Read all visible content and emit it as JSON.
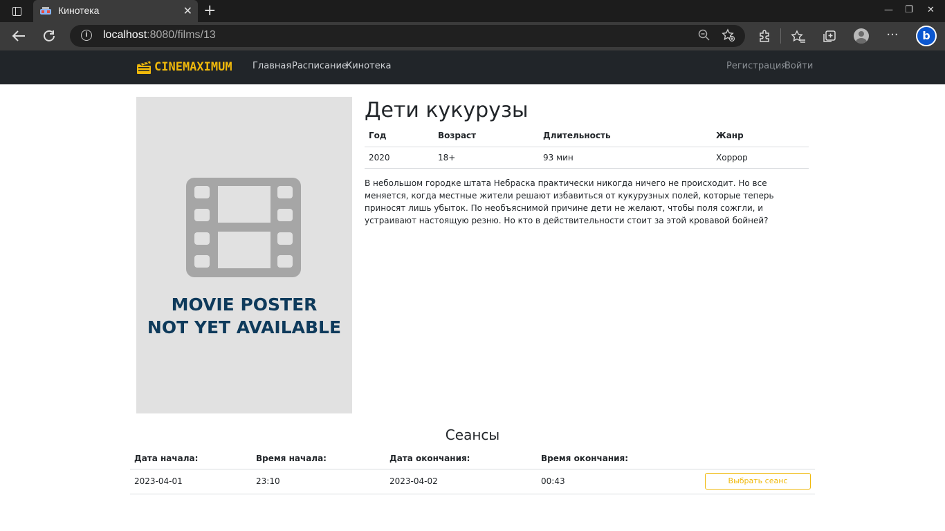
{
  "browser": {
    "tab_title": "Кинотека",
    "url_host": "localhost",
    "url_rest": ":8080/films/13",
    "new_tab_glyph": "+",
    "close_glyph": "✕",
    "window_controls": [
      "—",
      "❐",
      "✕"
    ],
    "toolbar_icons": [
      "back-icon",
      "refresh-icon",
      "extensions-icon",
      "favorites-icon",
      "collections-icon",
      "profile-icon",
      "more-icon",
      "bing-icon"
    ],
    "bing_label": "b"
  },
  "site": {
    "brand": "CINEMAXIMUM",
    "nav": [
      "Главная",
      "Расписание",
      "Кинотека"
    ],
    "auth": [
      "Регистрация",
      "Войти"
    ]
  },
  "film": {
    "poster_text_line1": "MOVIE POSTER",
    "poster_text_line2": "NOT YET AVAILABLE",
    "title": "Дети кукурузы",
    "headers": [
      "Год",
      "Возраст",
      "Длительность",
      "Жанр"
    ],
    "values": [
      "2020",
      "18+",
      "93 мин",
      "Хоррор"
    ],
    "description": "В небольшом городке штата Небраска практически никогда ничего не происходит. Но все меняется, когда местные жители решают избавиться от кукурузных полей, которые теперь приносят лишь убыток. По необъяснимой причине дети не желают, чтобы поля сожгли, и устраивают настоящую резню. Но кто в действительности стоит за этой кровавой бойней?"
  },
  "sessions": {
    "title": "Сеансы",
    "headers": [
      "Дата начала:",
      "Время начала:",
      "Дата окончания:",
      "Время окончания:"
    ],
    "rows": [
      {
        "start_date": "2023-04-01",
        "start_time": "23:10",
        "end_date": "2023-04-02",
        "end_time": "00:43",
        "button": "Выбрать сеанс"
      }
    ]
  },
  "colors": {
    "accent": "#f0b90b",
    "navbar": "#212529",
    "poster_bg": "#e1e1e1",
    "poster_text": "#0e3a5b"
  }
}
